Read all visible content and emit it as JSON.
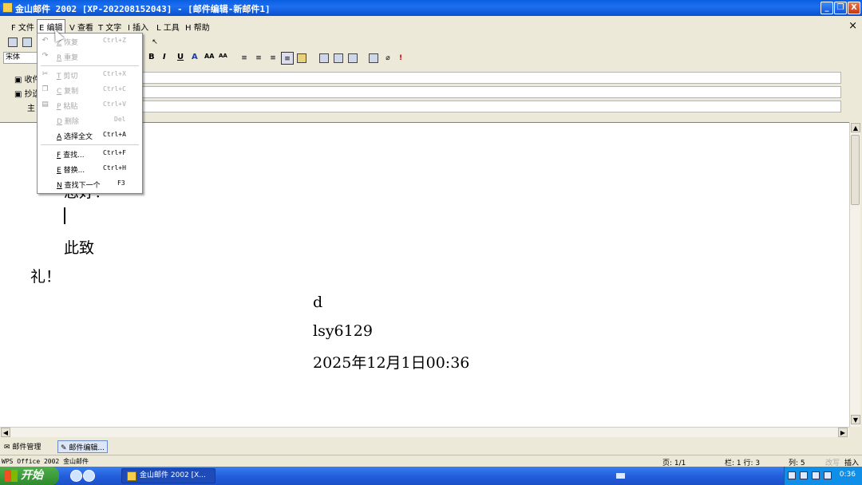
{
  "window": {
    "title": "金山邮件 2002 [XP-202208152043] - [邮件编辑-新邮件1]",
    "min_label": "_",
    "max_label": "❐",
    "close_label": "X"
  },
  "menubar": {
    "items": [
      {
        "label": "F 文件"
      },
      {
        "label": "E 编辑"
      },
      {
        "label": "V 查看"
      },
      {
        "label": "T 文字"
      },
      {
        "label": "I 插入"
      },
      {
        "label": "L 工具"
      },
      {
        "label": "H 帮助"
      }
    ],
    "mdi_close": "×"
  },
  "toolbar": {
    "font": "宋体",
    "bold": "B",
    "italic": "I",
    "underline": "U",
    "font_color": "A",
    "grow": "AA",
    "shrink": "AA"
  },
  "headers": {
    "to": "收件",
    "cc": "抄送",
    "subject": "主"
  },
  "document": {
    "lines": [
      "您好！",
      "此致",
      "礼！",
      "d",
      "lsy6129",
      "2025年12月1日00:36"
    ]
  },
  "edit_menu": {
    "items": [
      {
        "key": "Z",
        "label": "恢复",
        "shortcut": "Ctrl+Z",
        "icon": "undo-icon",
        "glyph": "↶"
      },
      {
        "key": "R",
        "label": "重复",
        "shortcut": "",
        "icon": "redo-icon",
        "glyph": "↷"
      },
      {
        "key": "T",
        "label": "剪切",
        "shortcut": "Ctrl+X",
        "icon": "cut-icon",
        "glyph": "✂"
      },
      {
        "key": "C",
        "label": "复制",
        "shortcut": "Ctrl+C",
        "icon": "copy-icon",
        "glyph": "❐"
      },
      {
        "key": "P",
        "label": "粘贴",
        "shortcut": "Ctrl+V",
        "icon": "paste-icon",
        "glyph": "▤"
      },
      {
        "key": "D",
        "label": "删除",
        "shortcut": "Del",
        "icon": "",
        "glyph": ""
      },
      {
        "key": "A",
        "label": "选择全文",
        "shortcut": "Ctrl+A",
        "icon": "",
        "glyph": ""
      },
      {
        "key": "F",
        "label": "查找...",
        "shortcut": "Ctrl+F",
        "icon": "",
        "glyph": ""
      },
      {
        "key": "E",
        "label": "替换...",
        "shortcut": "Ctrl+H",
        "icon": "",
        "glyph": ""
      },
      {
        "key": "N",
        "label": "查找下一个",
        "shortcut": "F3",
        "icon": "",
        "glyph": ""
      }
    ]
  },
  "tabs": {
    "mail_manager": "邮件管理",
    "mail_editor": "邮件编辑..."
  },
  "statusbar": {
    "app": "WPS Office 2002 金山邮件",
    "page": "页: 1/1",
    "row": "栏: 1  行: 3",
    "col": "列: 5",
    "mode_off": "改写",
    "mode": "插入"
  },
  "taskbar": {
    "start": "开始",
    "task": "金山邮件 2002 [X...",
    "clock": "0:36"
  }
}
